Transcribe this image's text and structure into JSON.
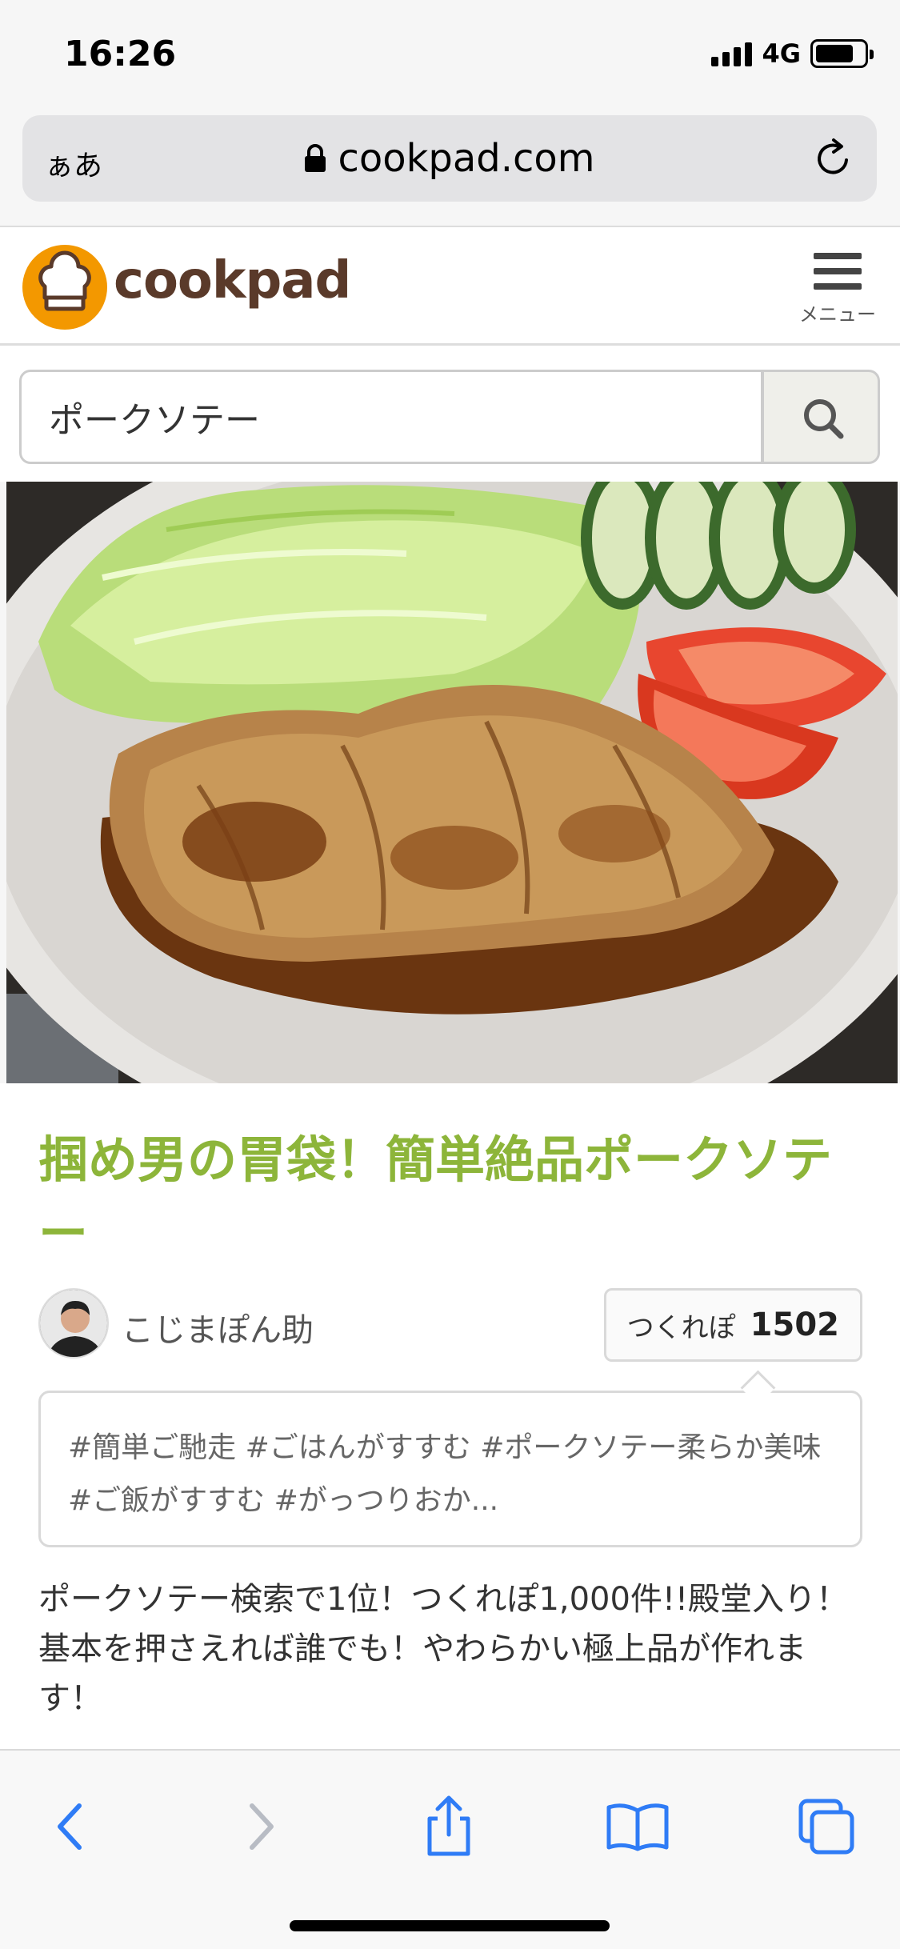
{
  "status": {
    "time": "16:26",
    "network": "4G"
  },
  "browser": {
    "text_size_label": "ぁあ",
    "url": "cookpad.com"
  },
  "site": {
    "logo_text": "cookpad",
    "menu_label": "メニュー"
  },
  "search": {
    "query": "ポークソテー"
  },
  "recipe": {
    "title": "掴め男の胃袋！簡単絶品ポークソテー",
    "author": "こじまぽん助",
    "tsukurepo_label": "つくれぽ",
    "tsukurepo_count": "1502",
    "tags": "#簡単ご馳走 #ごはんがすすむ #ポークソテー柔らか美味 #ご飯がすすむ #がっつりおか...",
    "description_line1": "ポークソテー検索で1位！つくれぽ1,000件!!殿堂入り！",
    "description_line2": "基本を押さえれば誰でも！やわらかい極上品が作れます！"
  },
  "toolbar": {
    "icons": [
      "back-icon",
      "forward-icon",
      "share-icon",
      "bookmarks-icon",
      "tabs-icon"
    ]
  },
  "colors": {
    "title_green": "#8db53a",
    "logo_orange": "#f39800",
    "logo_brown": "#5a3a2a",
    "ios_blue": "#2f7cf6"
  }
}
